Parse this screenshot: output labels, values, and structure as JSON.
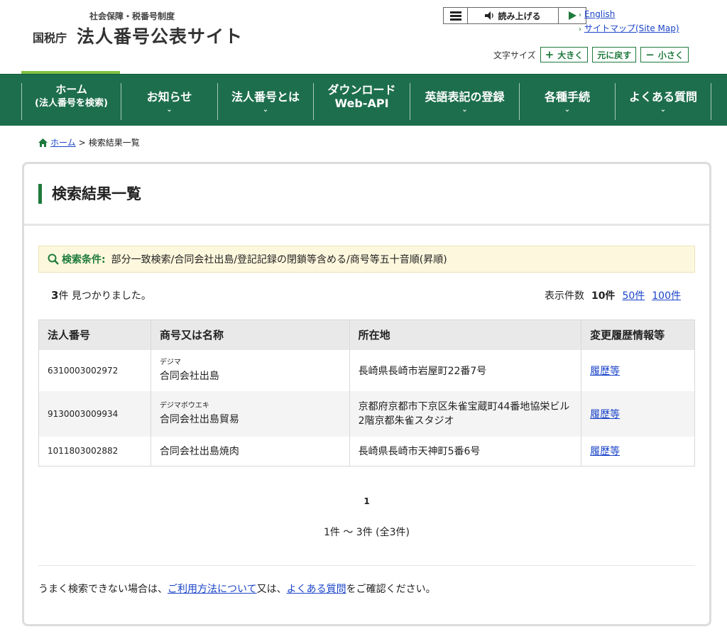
{
  "header": {
    "logo_sub": "社会保障・税番号制度",
    "logo_agency": "国税庁",
    "logo_name": "法人番号公表サイト",
    "read_label": "読み上げる",
    "lang_english": "English",
    "sitemap": "サイトマップ(Site Map)",
    "font_size_label": "文字サイズ",
    "font_bigger": "大きく",
    "font_reset": "元に戻す",
    "font_smaller": "小さく"
  },
  "nav": {
    "items": [
      {
        "line1": "ホーム",
        "line2": "(法人番号を検索)"
      },
      {
        "line1": "お知らせ"
      },
      {
        "line1": "法人番号とは"
      },
      {
        "line1": "ダウンロード",
        "line2": "Web-API"
      },
      {
        "line1": "英語表記の登録"
      },
      {
        "line1": "各種手続"
      },
      {
        "line1": "よくある質問"
      }
    ]
  },
  "breadcrumb": {
    "home": "ホーム",
    "sep": ">",
    "current": "検索結果一覧"
  },
  "main": {
    "title": "検索結果一覧",
    "condition_label": "検索条件:",
    "condition_text": "部分一致検索/合同会社出島/登記記録の閉鎖等含める/商号等五十音順(昇順)",
    "count_num": "3",
    "count_text": "件 見つかりました。",
    "perpage_label": "表示件数",
    "perpage_current": "10件",
    "perpage_50": "50件",
    "perpage_100": "100件"
  },
  "table": {
    "headers": [
      "法人番号",
      "商号又は名称",
      "所在地",
      "変更履歴情報等"
    ],
    "rows": [
      {
        "number": "6310003002972",
        "kana": "デジマ",
        "name": "合同会社出島",
        "address": "長崎県長崎市岩屋町22番7号",
        "history": "履歴等"
      },
      {
        "number": "9130003009934",
        "kana": "デジマボウエキ",
        "name": "合同会社出島貿易",
        "address": "京都府京都市下京区朱雀宝蔵町44番地協栄ビル2階京都朱雀スタジオ",
        "history": "履歴等"
      },
      {
        "number": "1011803002882",
        "kana": "",
        "name": "合同会社出島焼肉",
        "address": "長崎県長崎市天神町5番6号",
        "history": "履歴等"
      }
    ]
  },
  "pager": {
    "page": "1",
    "range": "1件 ～ 3件 (全3件)"
  },
  "help": {
    "prefix": "うまく検索できない場合は、",
    "link1": "ご利用方法について",
    "middle": "又は、",
    "link2": "よくある質問",
    "suffix": "をご確認ください。"
  },
  "colors": {
    "brand_green": "#1d6e4d",
    "accent_light_green": "#7fc143",
    "condition_bg": "#fdf8dd",
    "link": "#1a44c8"
  },
  "icons": [
    "menu-icon",
    "speaker-icon",
    "play-icon",
    "chevron-right-icon",
    "chevron-down-icon",
    "home-icon",
    "search-icon"
  ]
}
